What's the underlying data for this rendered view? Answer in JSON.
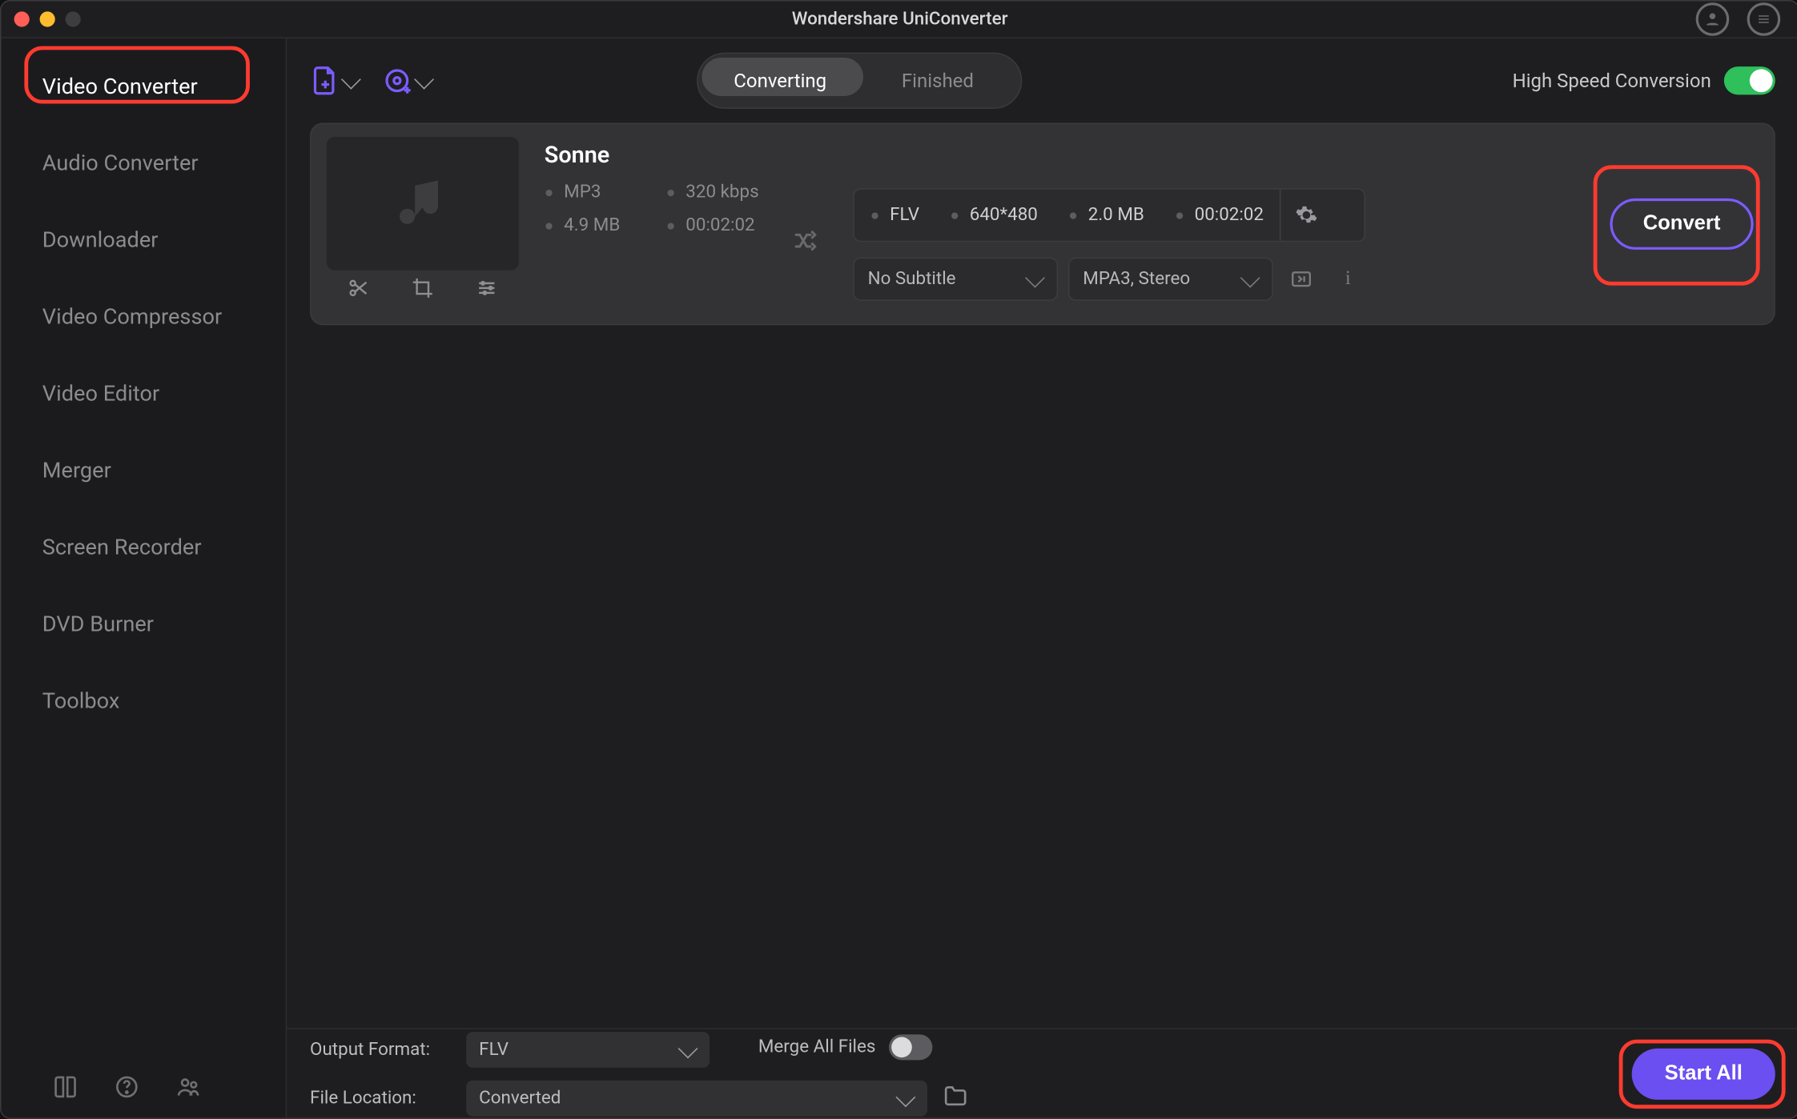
{
  "window": {
    "title": "Wondershare UniConverter"
  },
  "sidebar": {
    "items": [
      "Video Converter",
      "Audio Converter",
      "Downloader",
      "Video Compressor",
      "Video Editor",
      "Merger",
      "Screen Recorder",
      "DVD Burner",
      "Toolbox"
    ],
    "active_index": 0
  },
  "toolbar": {
    "seg_left": "Converting",
    "seg_right": "Finished",
    "seg_active": "left",
    "high_speed_label": "High Speed Conversion",
    "high_speed_on": true
  },
  "item": {
    "title": "Sonne",
    "src": {
      "format": "MP3",
      "bitrate": "320 kbps",
      "size": "4.9 MB",
      "duration": "00:02:02"
    },
    "out": {
      "format": "FLV",
      "res": "640*480",
      "size": "2.0 MB",
      "duration": "00:02:02"
    },
    "subtitle_dd": "No Subtitle",
    "audio_dd": "MPA3, Stereo",
    "convert_label": "Convert"
  },
  "bottom": {
    "output_format_label": "Output Format:",
    "output_format_value": "FLV",
    "file_location_label": "File Location:",
    "file_location_value": "Converted",
    "merge_label": "Merge All Files",
    "merge_on": false,
    "start_all_label": "Start All"
  }
}
